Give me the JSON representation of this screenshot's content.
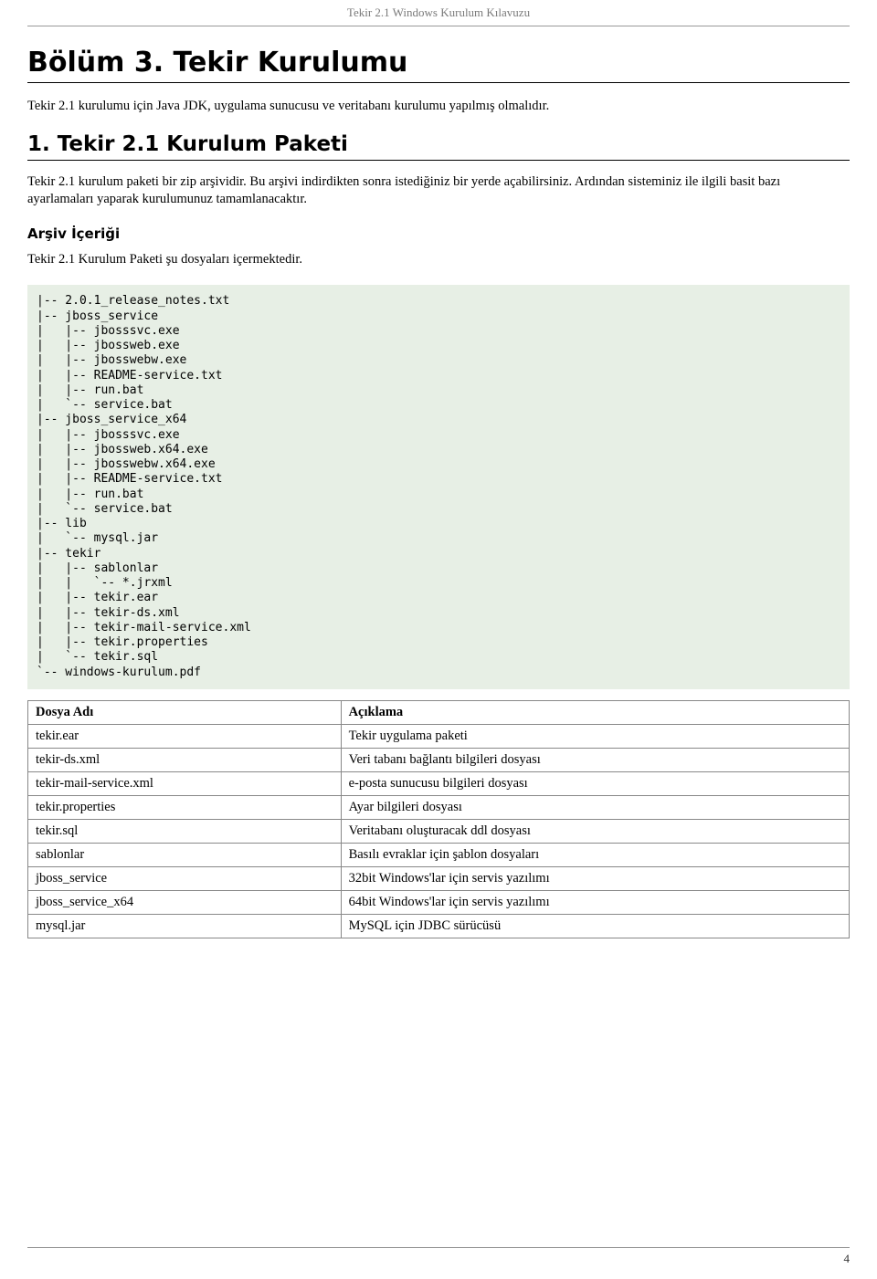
{
  "header": {
    "doc_title": "Tekir 2.1 Windows Kurulum Kılavuzu"
  },
  "chapter": {
    "title": "Bölüm 3. Tekir Kurulumu",
    "intro": "Tekir 2.1 kurulumu için Java JDK, uygulama sunucusu ve veritabanı kurulumu yapılmış olmalıdır."
  },
  "section1": {
    "title": "1. Tekir 2.1 Kurulum Paketi",
    "para": "Tekir 2.1 kurulum paketi bir zip arşividir. Bu arşivi indirdikten sonra istediğiniz bir yerde açabilirsiniz. Ardından sisteminiz ile ilgili basit bazı ayarlamaları yaparak kurulumunuz tamamlanacaktır.",
    "sub1": {
      "heading": "Arşiv İçeriği",
      "para": "Tekir 2.1 Kurulum Paketi şu dosyaları içermektedir."
    }
  },
  "tree": "|-- 2.0.1_release_notes.txt\n|-- jboss_service\n|   |-- jbosssvc.exe\n|   |-- jbossweb.exe\n|   |-- jbosswebw.exe\n|   |-- README-service.txt\n|   |-- run.bat\n|   `-- service.bat\n|-- jboss_service_x64\n|   |-- jbosssvc.exe\n|   |-- jbossweb.x64.exe\n|   |-- jbosswebw.x64.exe\n|   |-- README-service.txt\n|   |-- run.bat\n|   `-- service.bat\n|-- lib\n|   `-- mysql.jar\n|-- tekir\n|   |-- sablonlar\n|   |   `-- *.jrxml\n|   |-- tekir.ear\n|   |-- tekir-ds.xml\n|   |-- tekir-mail-service.xml\n|   |-- tekir.properties\n|   `-- tekir.sql\n`-- windows-kurulum.pdf",
  "table": {
    "header": {
      "col1": "Dosya Adı",
      "col2": "Açıklama"
    },
    "rows": [
      {
        "c1": "tekir.ear",
        "c2": "Tekir uygulama paketi"
      },
      {
        "c1": "tekir-ds.xml",
        "c2": "Veri tabanı bağlantı bilgileri dosyası"
      },
      {
        "c1": "tekir-mail-service.xml",
        "c2": "e-posta sunucusu bilgileri dosyası"
      },
      {
        "c1": "tekir.properties",
        "c2": "Ayar bilgileri dosyası"
      },
      {
        "c1": "tekir.sql",
        "c2": "Veritabanı oluşturacak ddl dosyası"
      },
      {
        "c1": "sablonlar",
        "c2": "Basılı evraklar için şablon dosyaları"
      },
      {
        "c1": "jboss_service",
        "c2": "32bit Windows'lar için servis yazılımı"
      },
      {
        "c1": "jboss_service_x64",
        "c2": "64bit Windows'lar için servis yazılımı"
      },
      {
        "c1": "mysql.jar",
        "c2": "MySQL için JDBC sürücüsü"
      }
    ]
  },
  "page_number": "4"
}
